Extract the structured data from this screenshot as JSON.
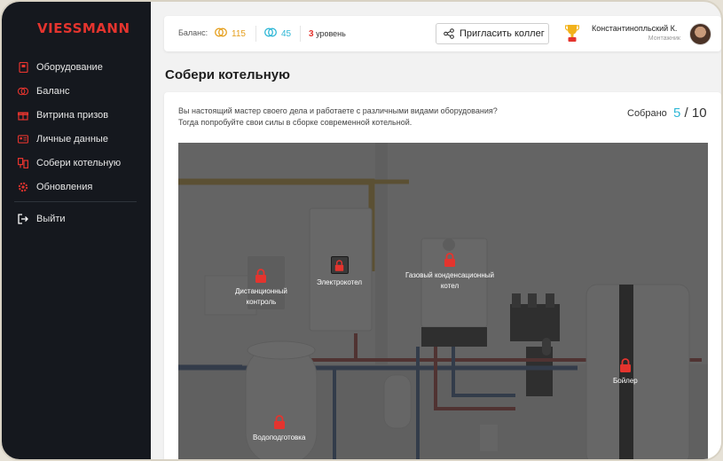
{
  "brand": {
    "logo": "VIESSMANN",
    "accent": "#e4342e"
  },
  "sidebar": {
    "items": [
      {
        "label": "Оборудование",
        "icon": "equipment-icon"
      },
      {
        "label": "Баланс",
        "icon": "coins-icon"
      },
      {
        "label": "Витрина призов",
        "icon": "gift-icon"
      },
      {
        "label": "Личные данные",
        "icon": "id-card-icon"
      },
      {
        "label": "Собери котельную",
        "icon": "boiler-room-icon"
      },
      {
        "label": "Обновления",
        "icon": "gear-icon"
      }
    ],
    "logout_label": "Выйти"
  },
  "topbar": {
    "balance_label": "Баланс:",
    "balance_gold": "115",
    "balance_blue": "45",
    "level_num": "3",
    "level_label": "уровень",
    "invite_label": "Пригласить коллег",
    "user_name": "Константинопльский К.",
    "user_role": "Монтажник"
  },
  "main": {
    "title": "Собери котельную",
    "desc_line1": "Вы настоящий мастер своего дела и работаете с различными видами оборудования?",
    "desc_line2": "Тогда попробуйте свои силы в сборке современной котельной.",
    "collected_label": "Собрано",
    "collected_count": "5",
    "collected_total": "/ 10",
    "hotspots": {
      "remote": "Дистанционный\nконтроль",
      "electric": "Электрокотел",
      "gas": "Газовый конденсационный\nкотел",
      "boiler": "Бойлер",
      "water": "Водоподготовка"
    }
  }
}
